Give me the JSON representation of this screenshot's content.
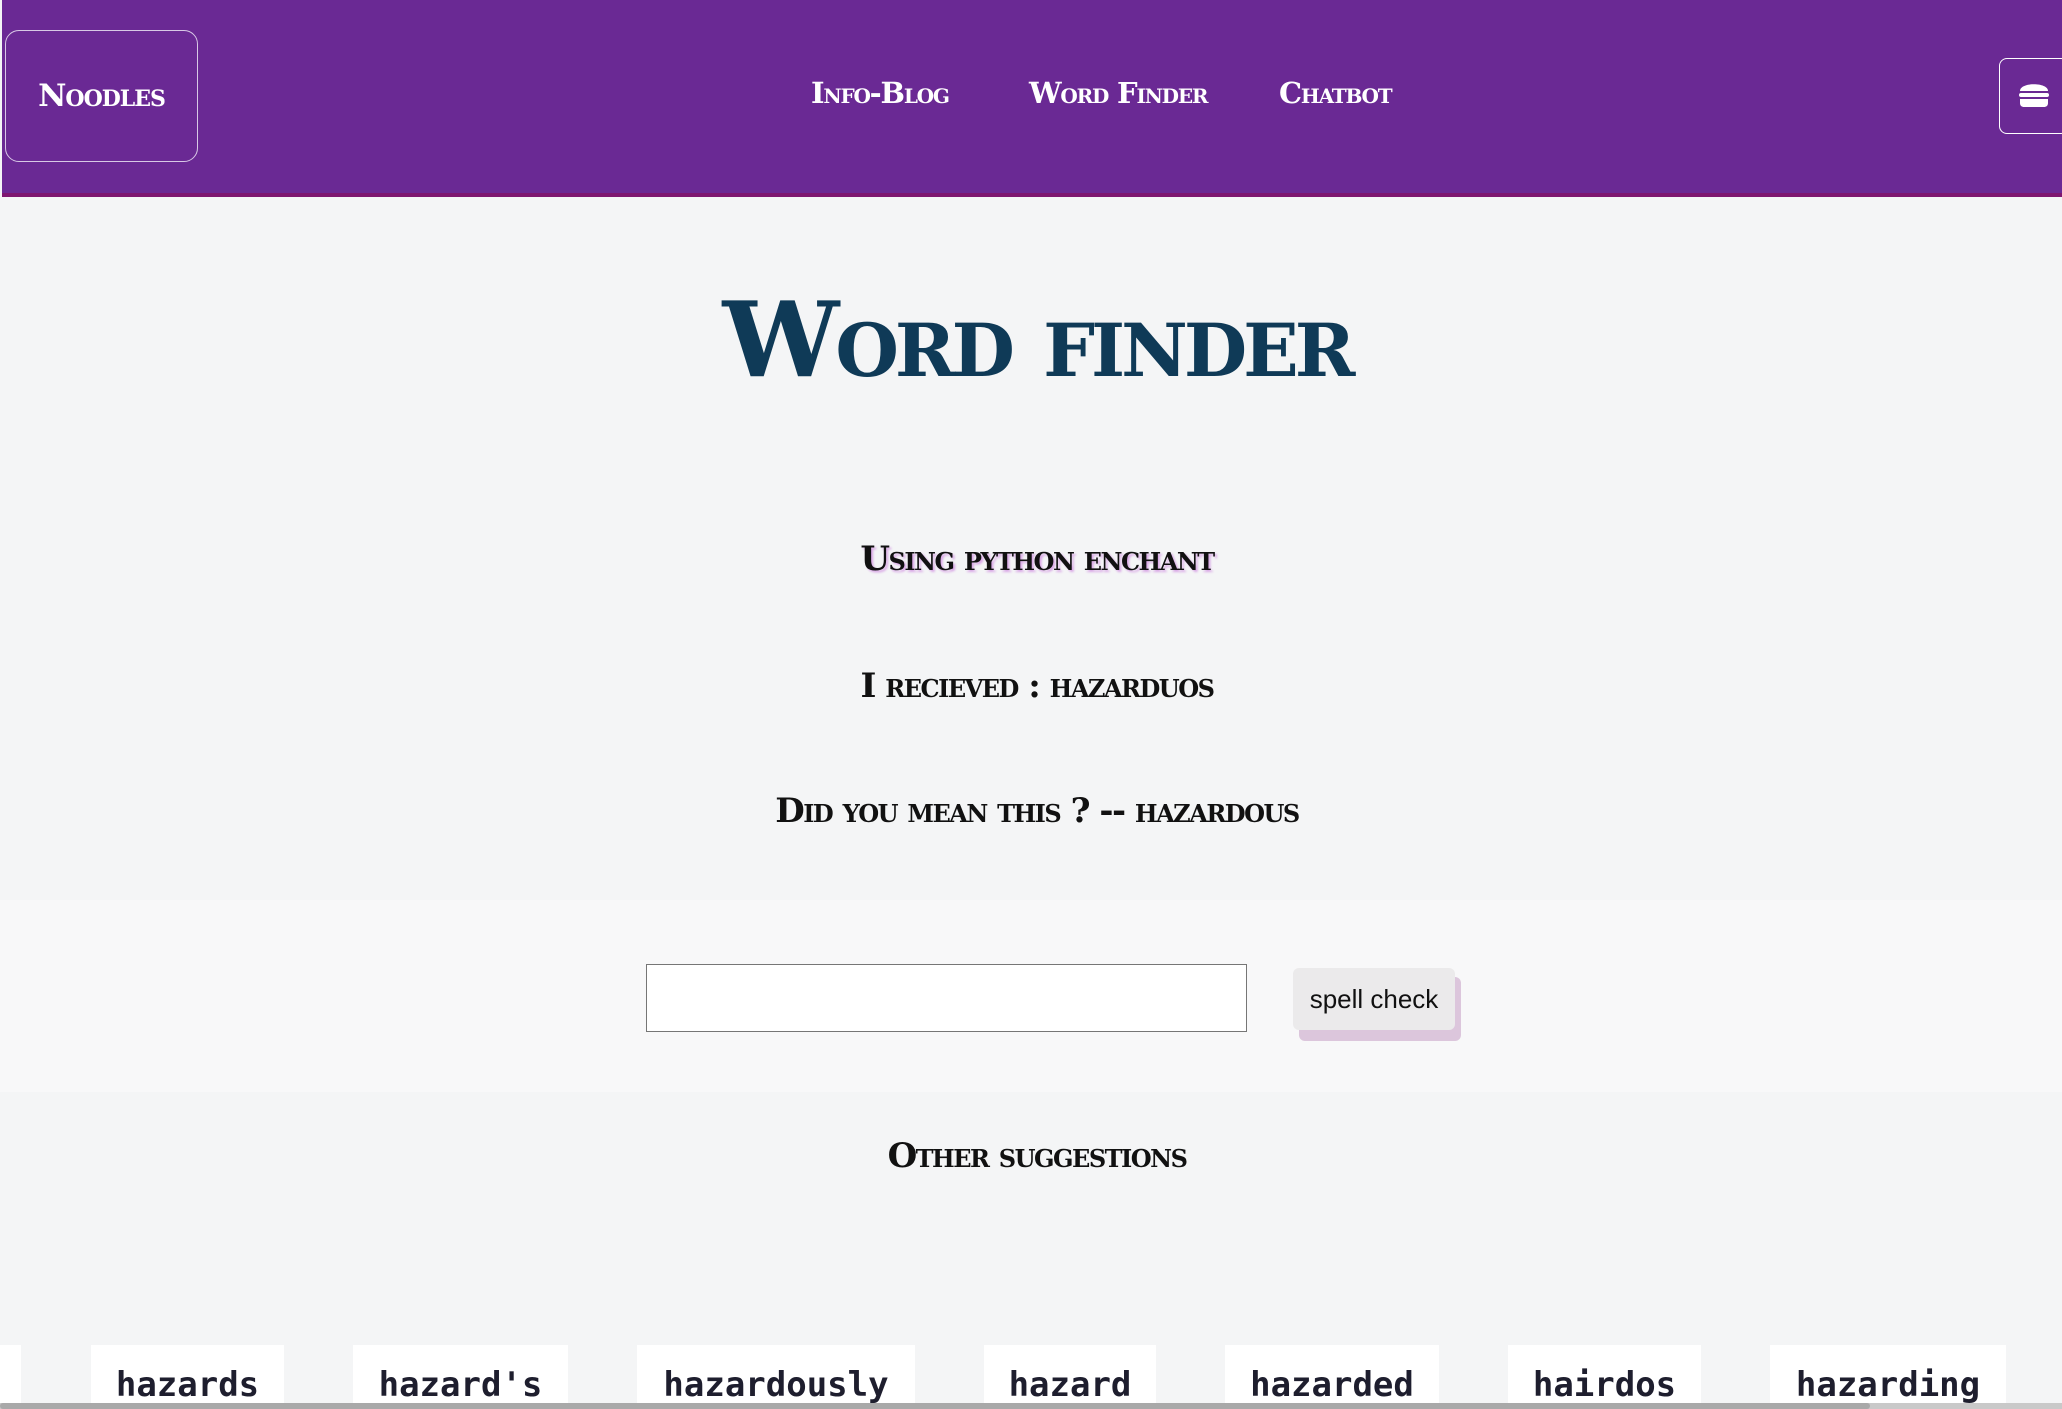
{
  "navbar": {
    "brand": "Noodles",
    "links": [
      "Info-Blog",
      "Word Finder",
      "Chatbot"
    ],
    "toggler_icon": "burger-icon"
  },
  "main": {
    "title": "Word finder",
    "subtitle": "Using python enchant",
    "received": "I recieved : hazarduos",
    "did_you_mean": "Did you mean this ? -- hazardous"
  },
  "form": {
    "input_value": "",
    "button_label": "spell check"
  },
  "suggestions": {
    "heading": "Other suggestions",
    "items": [
      "hazards",
      "hazard's",
      "hazardously",
      "hazard",
      "hazarded",
      "hairdos",
      "hazarding"
    ]
  },
  "colors": {
    "navbar": "#6a2994",
    "title": "#0f3a57",
    "background": "#f4f5f6"
  }
}
